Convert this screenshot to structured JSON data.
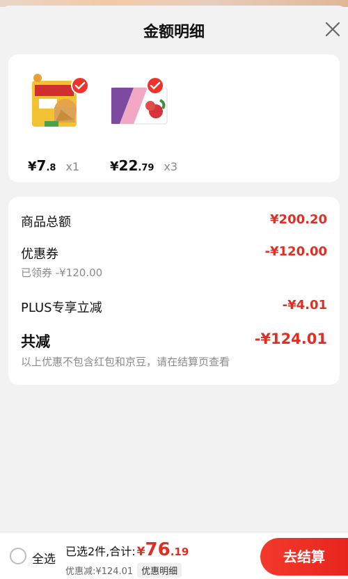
{
  "header": {
    "title": "金额明细"
  },
  "products": [
    {
      "price_symbol": "¥",
      "price_int": "7",
      "price_dec": ".8",
      "qty": "x1",
      "thumbnail_icon": "food-package-thumbnail"
    },
    {
      "price_symbol": "¥",
      "price_int": "22",
      "price_dec": ".79",
      "qty": "x3",
      "thumbnail_icon": "fruit-box-thumbnail"
    }
  ],
  "summary": {
    "goods_total_label": "商品总额",
    "goods_total_value": "¥200.20",
    "coupon_label": "优惠券",
    "coupon_value": "-¥120.00",
    "coupon_sub": "已领券 -¥120.00",
    "plus_label": "PLUS专享立减",
    "plus_value": "-¥4.01",
    "total_reduce_label": "共减",
    "total_reduce_value": "-¥124.01",
    "note": "以上优惠不包含红包和京豆，请在结算页查看"
  },
  "bottom": {
    "select_all": "全选",
    "selected_text": "已选2件,合计:",
    "total_symbol": "¥",
    "total_int": "76",
    "total_dec": ".19",
    "discount_text": "优惠减:¥124.01",
    "detail_tag": "优惠明细",
    "checkout_label": "去结算"
  },
  "colors": {
    "accent": "#e02e24",
    "check": "#f0322b"
  }
}
